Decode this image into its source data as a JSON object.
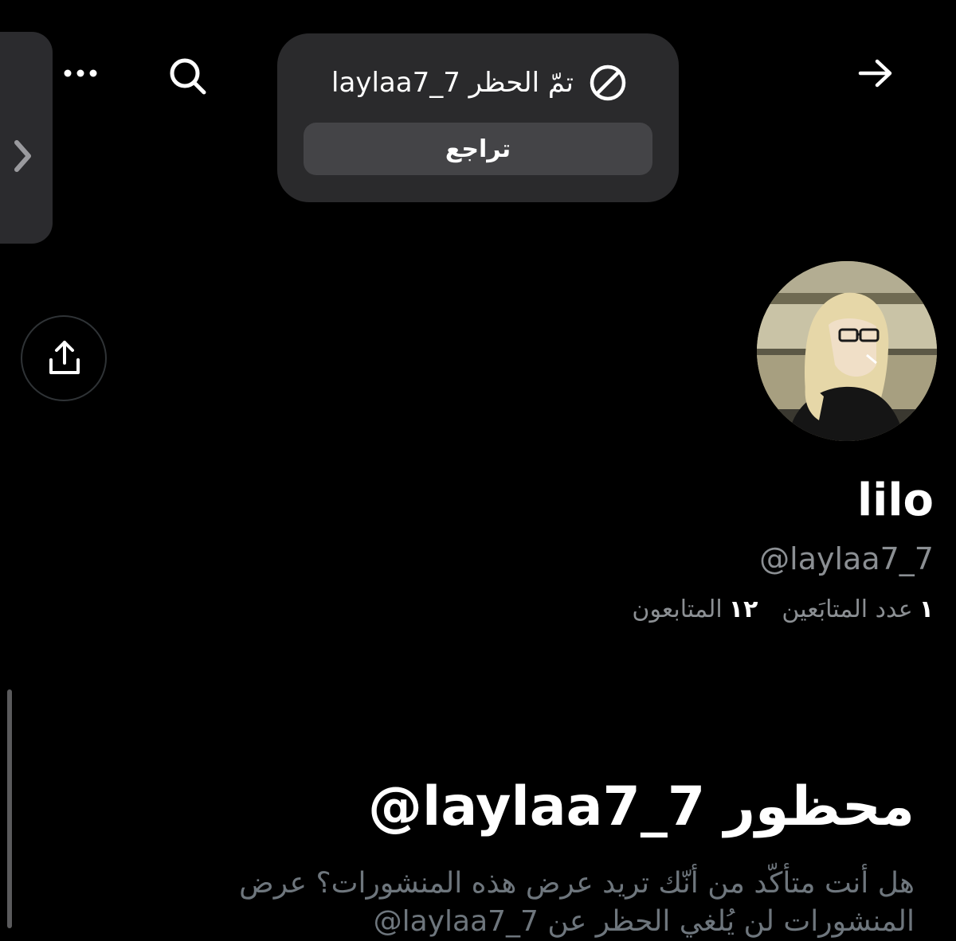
{
  "toast": {
    "message": "تمّ الحظر laylaa7_7",
    "undo_label": "تراجع"
  },
  "profile": {
    "display_name": "lilo",
    "handle": "@laylaa7_7",
    "following_count": "١",
    "following_label": "عدد المتابَعين",
    "followers_count": "١٢",
    "followers_label": "المتابعون"
  },
  "blocked": {
    "title": "محظور laylaa7_7@",
    "description": "هل أنت متأكّد من أنّك تريد عرض هذه المنشورات؟ عرض المنشورات لن يُلغي الحظر عن laylaa7_7@"
  },
  "icons": {
    "top_bar": [
      "more-icon",
      "search-icon",
      "back-arrow-icon"
    ],
    "toast": "block-icon",
    "side_handle": "chevron-right-icon",
    "share": "share-icon"
  },
  "colors": {
    "background": "#000000",
    "toast_background": "#2a2a2c",
    "undo_button": "#444447",
    "primary_text": "#ffffff",
    "secondary_text": "#8b8f93"
  }
}
